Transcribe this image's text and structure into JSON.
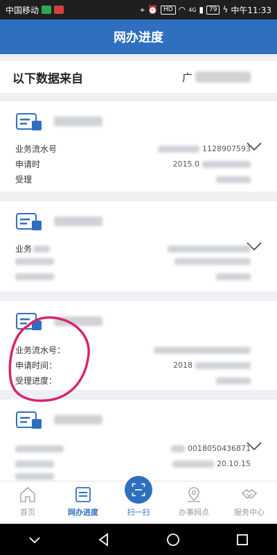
{
  "status": {
    "carrier": "中国移动",
    "battery": "79",
    "time": "中午11:33",
    "hd": "HD",
    "net": "4G"
  },
  "header": {
    "title": "网办进度"
  },
  "source": {
    "label": "以下数据来自",
    "value_visible_char": "广"
  },
  "cards": [
    {
      "rows": [
        {
          "label": "业务流水号",
          "value_tail": "1128907593"
        },
        {
          "label": "申请时",
          "value_tail": "2015.0"
        },
        {
          "label": "受理",
          "value_tail": ""
        }
      ]
    },
    {
      "rows": [
        {
          "label": "业务",
          "value_tail": ""
        },
        {
          "label": "",
          "value_tail": ""
        },
        {
          "label": "",
          "value_tail": ""
        }
      ]
    },
    {
      "rows": [
        {
          "label": "业务流水号：",
          "value_tail": ""
        },
        {
          "label": "申请时间：",
          "value_tail": "2018"
        },
        {
          "label": "受理进度：",
          "value_tail": ""
        }
      ]
    },
    {
      "rows": [
        {
          "label": "",
          "value_tail": "0018050436871"
        },
        {
          "label": "",
          "value_tail": "20.10.15"
        },
        {
          "label": "",
          "value_tail": ""
        }
      ]
    }
  ],
  "tabs": [
    {
      "label": "首页",
      "icon": "home-icon"
    },
    {
      "label": "网办进度",
      "icon": "progress-list-icon"
    },
    {
      "label": "扫一扫",
      "icon": "scan-icon"
    },
    {
      "label": "办事网点",
      "icon": "map-pin-icon"
    },
    {
      "label": "服务中心",
      "icon": "service-handshake-icon"
    }
  ],
  "colors": {
    "primary": "#2f6fc0",
    "annotation": "#d8246d"
  }
}
